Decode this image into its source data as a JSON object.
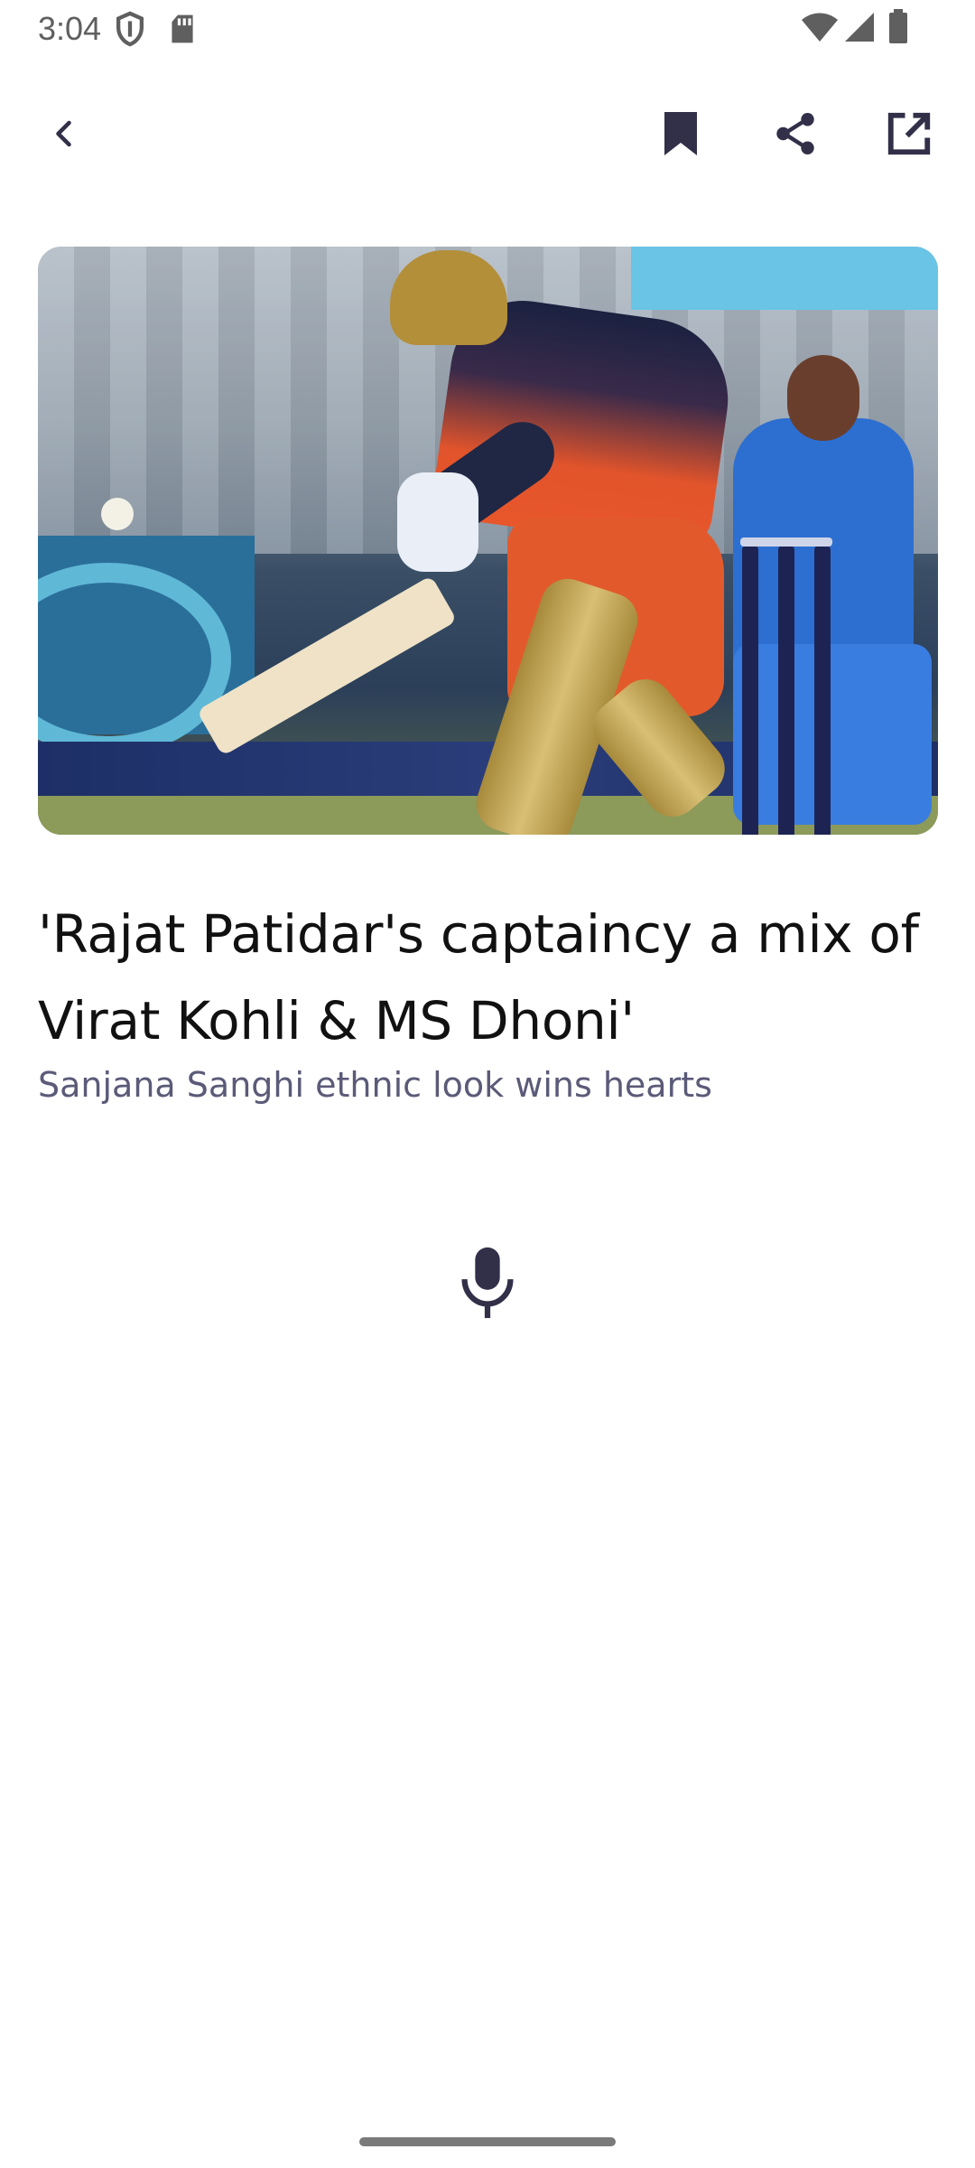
{
  "status_bar": {
    "time": "3:04",
    "icons": [
      "shield-icon",
      "sd-card-icon",
      "wifi-icon",
      "signal-icon",
      "battery-icon"
    ]
  },
  "toolbar": {
    "icons": [
      "back-icon",
      "bookmark-icon",
      "share-icon",
      "open-external-icon"
    ]
  },
  "article": {
    "image_description": "cricket-batter-hero-image",
    "headline": "'Rajat Patidar's captaincy a mix of Virat Kohli & MS Dhoni'",
    "subtitle": "Sanjana Sanghi ethnic look wins hearts"
  },
  "mic": {
    "icon": "microphone-icon"
  },
  "colors": {
    "icon_dark": "#323048",
    "subtitle": "#5b5a78",
    "headline": "#111111",
    "status_gray": "#5f5f5f"
  }
}
